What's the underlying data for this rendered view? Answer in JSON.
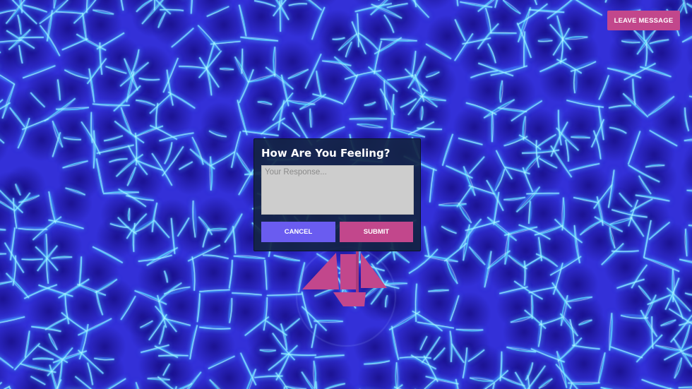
{
  "header": {
    "leave_message_label": "LEAVE MESSAGE"
  },
  "dialog": {
    "title": "How Are You Feeling?",
    "response_placeholder": "Your Response...",
    "response_value": "",
    "cancel_label": "CANCEL",
    "submit_label": "SUBMIT"
  },
  "colors": {
    "water_deep": "#1f1aa8",
    "water_mid": "#3330d8",
    "caustic_highlight": "#62e8ff",
    "accent_pink": "#c2478c",
    "cancel_purple": "#6a5cf0",
    "dialog_bg": "#142444",
    "boat": "#c2478c"
  },
  "icons": {
    "boat": "sailboat-icon"
  }
}
